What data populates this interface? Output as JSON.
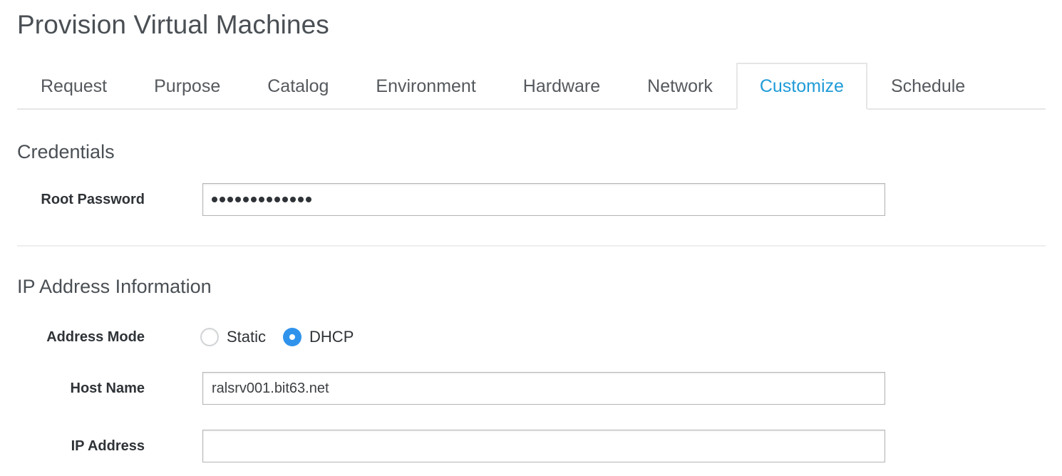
{
  "page": {
    "title": "Provision Virtual Machines"
  },
  "tabs": {
    "items": [
      {
        "label": "Request",
        "active": false
      },
      {
        "label": "Purpose",
        "active": false
      },
      {
        "label": "Catalog",
        "active": false
      },
      {
        "label": "Environment",
        "active": false
      },
      {
        "label": "Hardware",
        "active": false
      },
      {
        "label": "Network",
        "active": false
      },
      {
        "label": "Customize",
        "active": true
      },
      {
        "label": "Schedule",
        "active": false
      }
    ],
    "active_label": "Customize",
    "active_color": "#1f9bd8",
    "inactive_color": "#55595d"
  },
  "credentials": {
    "section_title": "Credentials",
    "root_password": {
      "label": "Root Password",
      "value": "•••••••••••••",
      "masked_char_count": 13,
      "placeholder": ""
    }
  },
  "ip_information": {
    "section_title": "IP Address Information",
    "address_mode": {
      "label": "Address Mode",
      "options": [
        {
          "label": "Static",
          "selected": false
        },
        {
          "label": "DHCP",
          "selected": true
        }
      ],
      "selected": "DHCP",
      "selected_color": "#2f93ec"
    },
    "host_name": {
      "label": "Host Name",
      "value": "ralsrv001.bit63.net",
      "placeholder": ""
    },
    "ip_address": {
      "label": "IP Address",
      "value": "",
      "placeholder": ""
    }
  }
}
